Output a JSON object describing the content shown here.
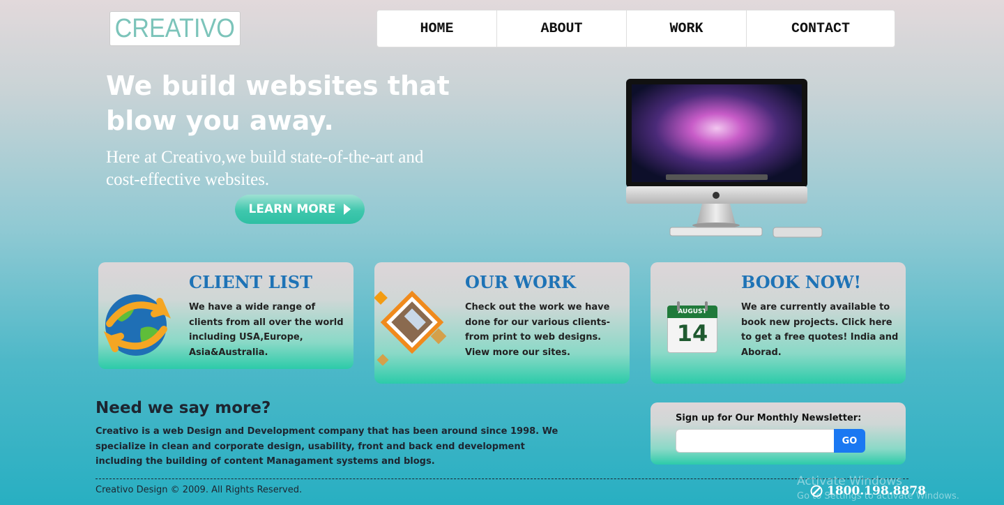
{
  "logo": {
    "text": "CREATIVO"
  },
  "nav": {
    "items": [
      "HOME",
      "ABOUT",
      "WORK",
      "CONTACT"
    ]
  },
  "hero": {
    "title": "We build websites that blow you away.",
    "subtitle": "Here at Creativo,we build state-of-the-art and cost-effective websites.",
    "button_label": "LEARN MORE",
    "image": "imac-computer-illustration"
  },
  "cards": [
    {
      "title": "CLIENT LIST",
      "icon": "globe-arrows-icon",
      "text": "We have a wide range of clients from all over the world including USA,Europe, Asia&Australia."
    },
    {
      "title": "OUR WORK",
      "icon": "portfolio-photo-icon",
      "text": "Check out the work we have done for our various clients-from print to web designs. View more our sites."
    },
    {
      "title": "BOOK NOW!",
      "icon": "calendar-icon",
      "text": "We are currently available to book new projects. Click here to get a free quotes! India and Aborad.",
      "calendar_month": "AUGUST",
      "calendar_day": "14"
    }
  ],
  "about": {
    "title": "Need we say more?",
    "text": "Creativo is a web Design and Development company that has been around since 1998. We specialize in clean and corporate design, usability, front and back end development including the building of content Managament systems and blogs."
  },
  "newsletter": {
    "label": "Sign up for Our Monthly Newsletter:",
    "input_value": "",
    "button_label": "GO"
  },
  "footer": {
    "copyright": "Creativo Design © 2009. All Rights Reserved.",
    "phone": "1800.198.8878",
    "phone_icon": "phone-icon"
  },
  "watermark": {
    "line1": "Activate Windows",
    "line2": "Go to Settings to activate Windows."
  },
  "colors": {
    "accent": "#1e73b6",
    "button_teal": "#2ebfa3",
    "newsletter_button": "#1a78f2",
    "logo_text": "#7cc4ba"
  }
}
